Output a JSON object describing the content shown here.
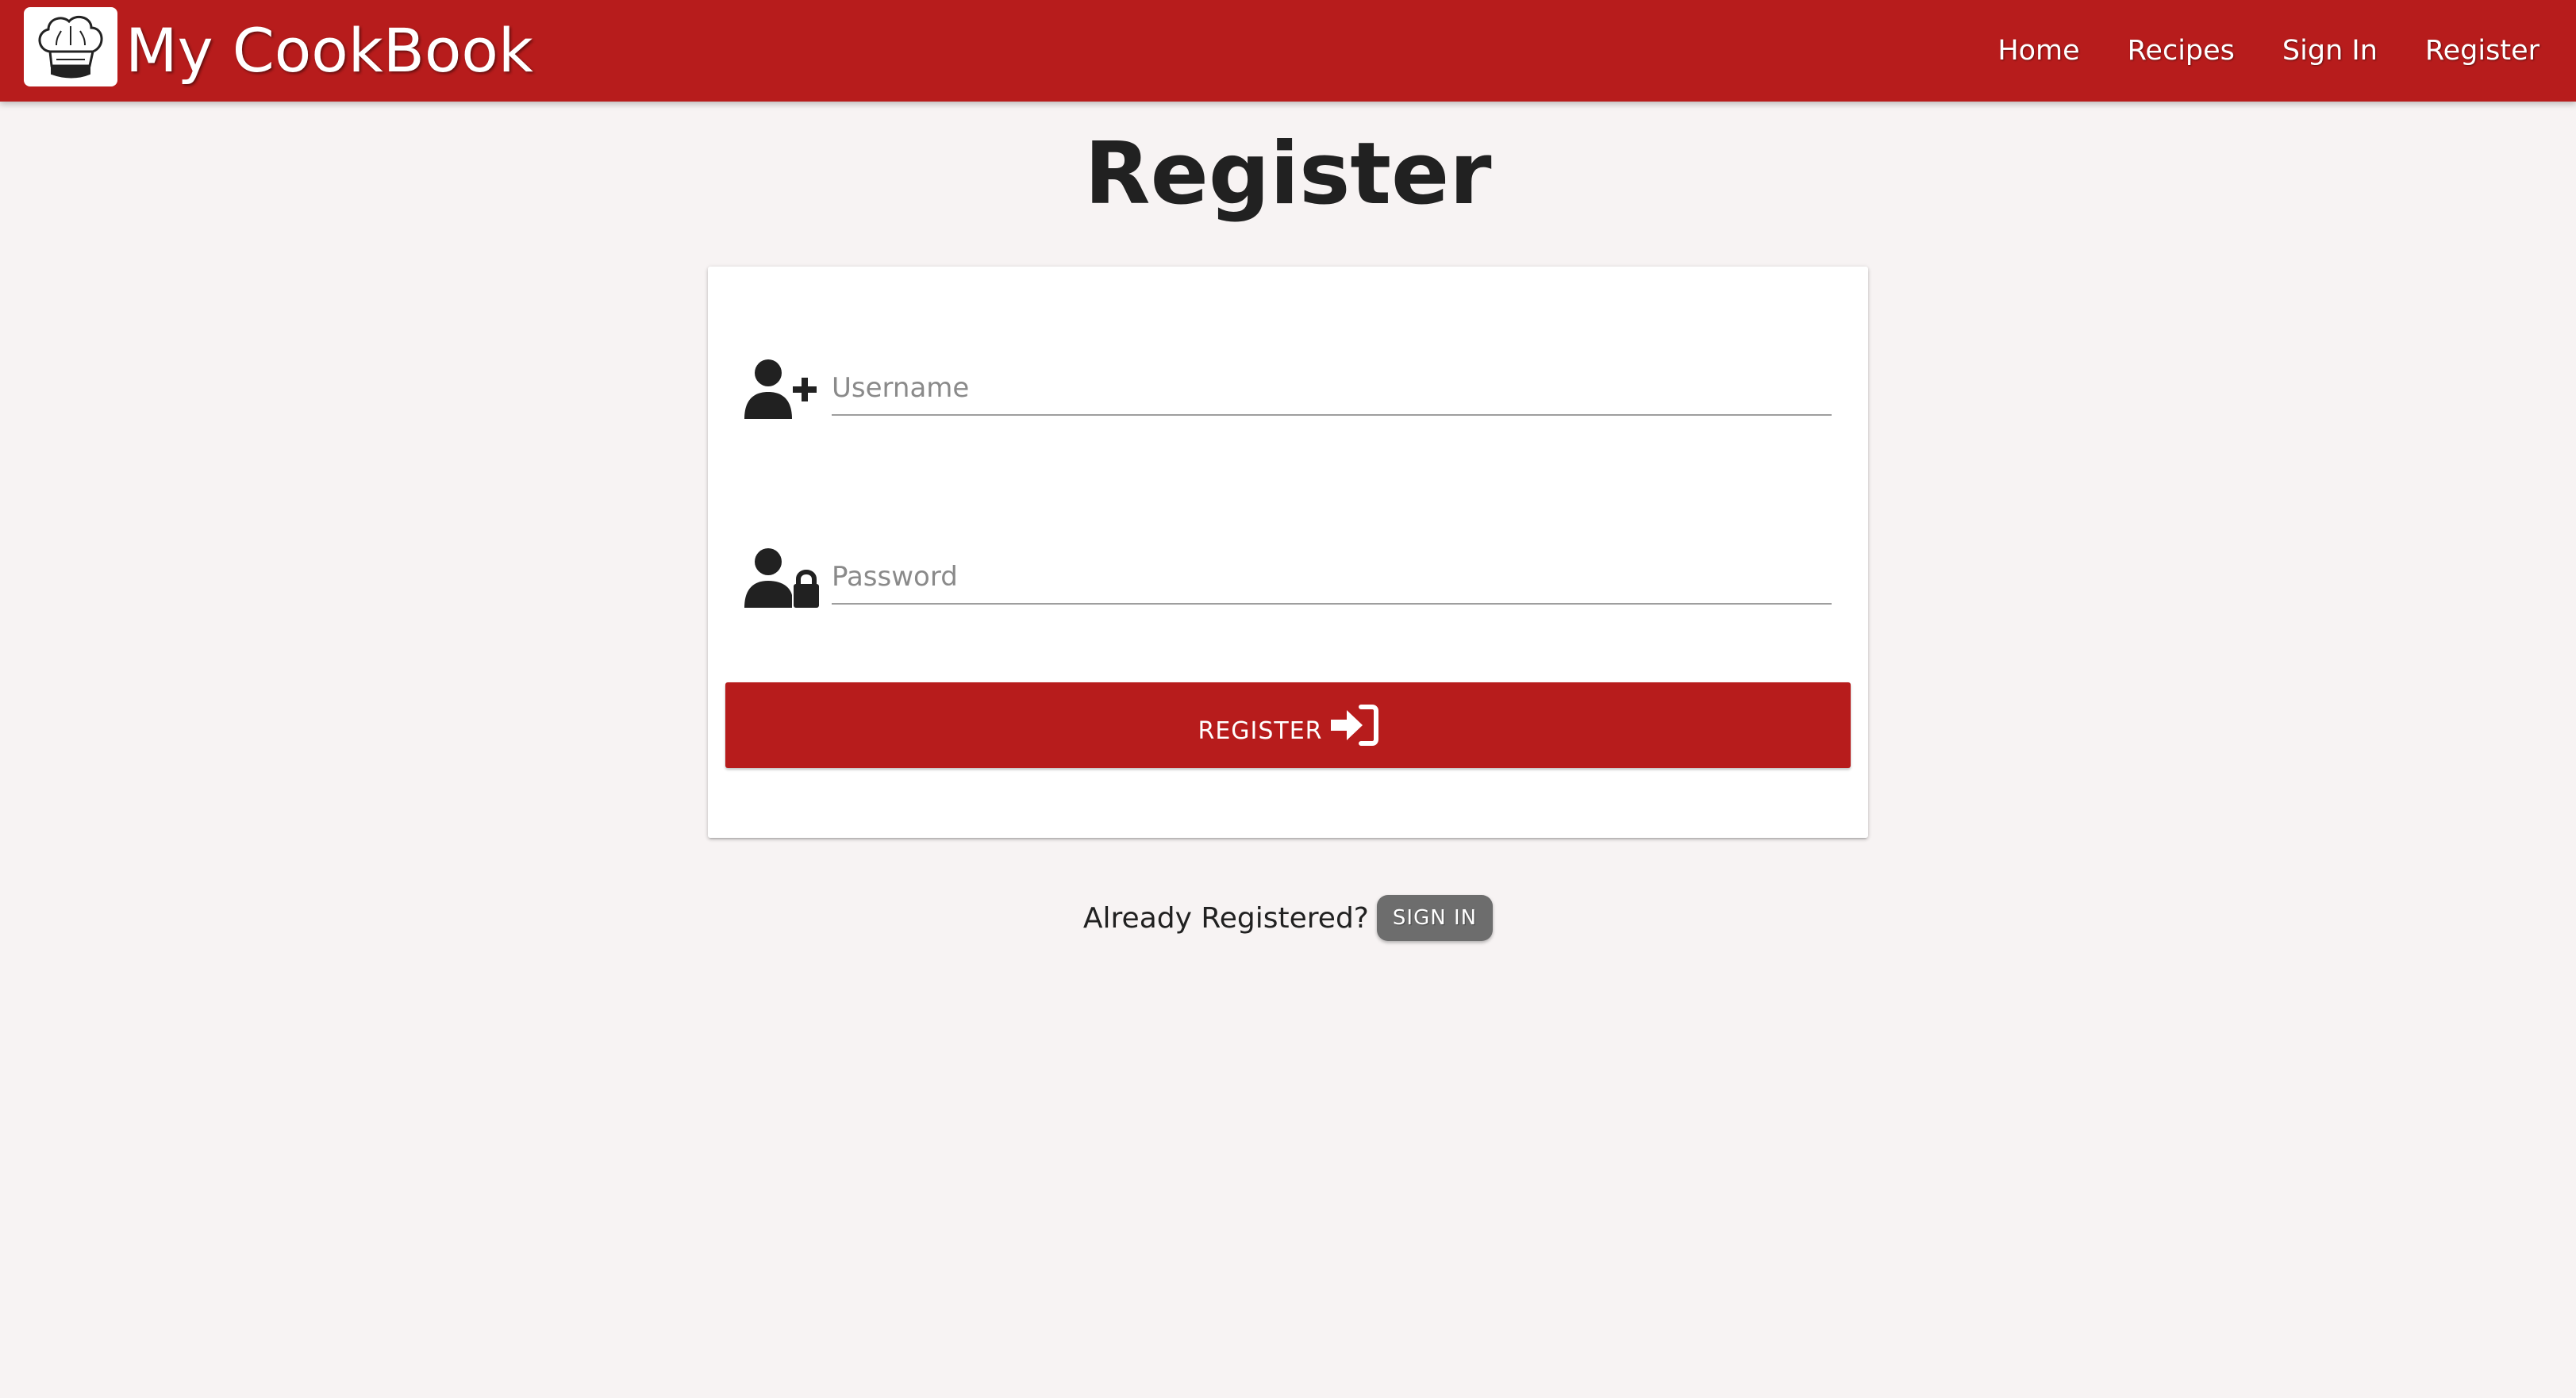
{
  "app": {
    "brand": "My CookBook",
    "logo_icon": "chef-hat-icon",
    "accent_color": "#b71c1c"
  },
  "nav": {
    "items": [
      {
        "label": "Home"
      },
      {
        "label": "Recipes"
      },
      {
        "label": "Sign In"
      },
      {
        "label": "Register"
      }
    ]
  },
  "page": {
    "title": "Register"
  },
  "form": {
    "username": {
      "placeholder": "Username",
      "value": "",
      "icon": "user-plus-icon"
    },
    "password": {
      "placeholder": "Password",
      "value": "",
      "icon": "user-lock-icon"
    },
    "submit": {
      "label": "REGISTER",
      "icon": "sign-in-icon"
    }
  },
  "footer": {
    "prompt": "Already Registered?",
    "signin_label": "SIGN IN",
    "signin_color": "#6d6d6d"
  }
}
